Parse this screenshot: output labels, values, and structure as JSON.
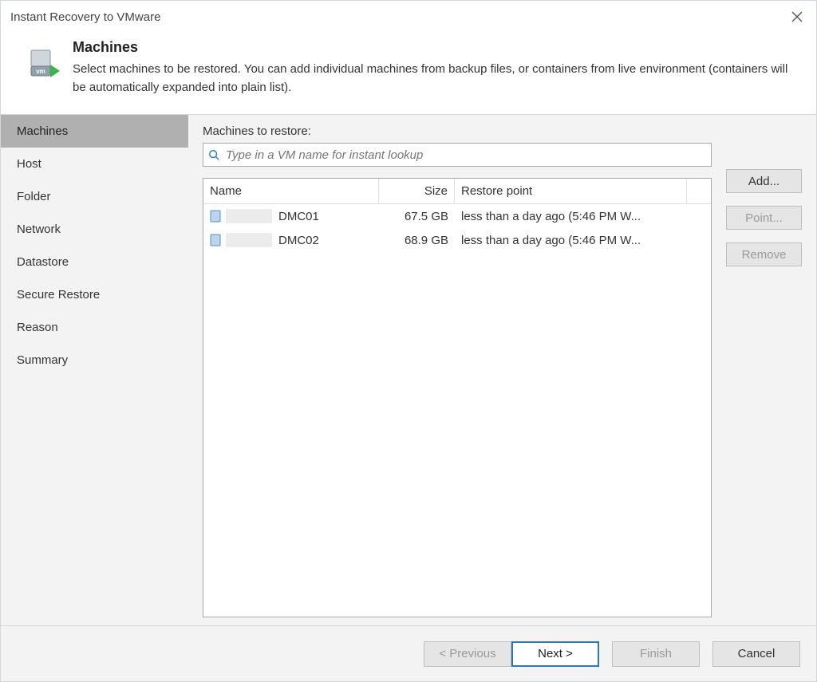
{
  "window": {
    "title": "Instant Recovery to VMware"
  },
  "header": {
    "title": "Machines",
    "description": "Select machines to be restored. You can add individual machines from backup files, or containers from live environment (containers will be automatically expanded into plain list)."
  },
  "sidebar": {
    "steps": [
      {
        "label": "Machines",
        "active": true
      },
      {
        "label": "Host"
      },
      {
        "label": "Folder"
      },
      {
        "label": "Network"
      },
      {
        "label": "Datastore"
      },
      {
        "label": "Secure Restore"
      },
      {
        "label": "Reason"
      },
      {
        "label": "Summary"
      }
    ]
  },
  "main": {
    "label": "Machines to restore:",
    "search_placeholder": "Type in a VM name for instant lookup",
    "columns": {
      "name": "Name",
      "size": "Size",
      "restore_point": "Restore point"
    },
    "rows": [
      {
        "name": "DMC01",
        "size": "67.5 GB",
        "restore_point": "less than a day ago (5:46 PM W..."
      },
      {
        "name": "DMC02",
        "size": "68.9 GB",
        "restore_point": "less than a day ago (5:46 PM W..."
      }
    ],
    "buttons": {
      "add": "Add...",
      "point": "Point...",
      "remove": "Remove"
    }
  },
  "footer": {
    "previous": "< Previous",
    "next": "Next >",
    "finish": "Finish",
    "cancel": "Cancel"
  }
}
